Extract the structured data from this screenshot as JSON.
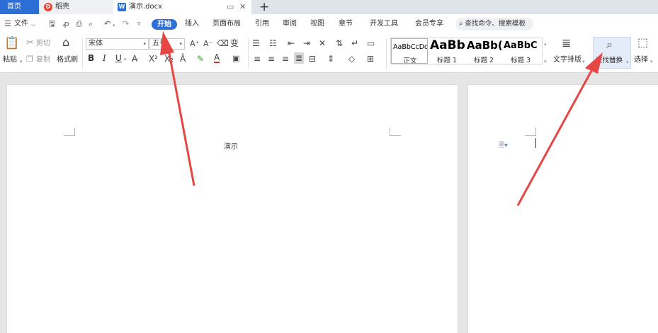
{
  "tabs": {
    "home": "首页",
    "daoke": "稻壳",
    "document": "演示.docx",
    "new_tab": "+"
  },
  "menu": {
    "file": "文件",
    "items": [
      "开始",
      "插入",
      "页面布局",
      "引用",
      "审阅",
      "视图",
      "章节",
      "开发工具",
      "会员专享"
    ],
    "search_placeholder": "查找命令、搜索模板"
  },
  "ribbon": {
    "paste": "粘贴",
    "cut": "剪切",
    "copy": "复制",
    "format_painter": "格式刷",
    "font_name": "宋体",
    "font_size": "五号",
    "bold": "B",
    "italic": "I",
    "underline": "U",
    "styles": [
      {
        "preview": "AaBbCcDd",
        "label": "正文"
      },
      {
        "preview": "AaBb",
        "label": "标题 1"
      },
      {
        "preview": "AaBb(",
        "label": "标题 2"
      },
      {
        "preview": "AaBbC",
        "label": "标题 3"
      }
    ],
    "text_layout": "文字排版",
    "find_replace": "查找替换",
    "select": "选择"
  },
  "document": {
    "page1_text": "演示"
  },
  "colors": {
    "accent": "#2f70d8",
    "arrow": "#e84545",
    "home_tab": "#2b6fd6"
  }
}
